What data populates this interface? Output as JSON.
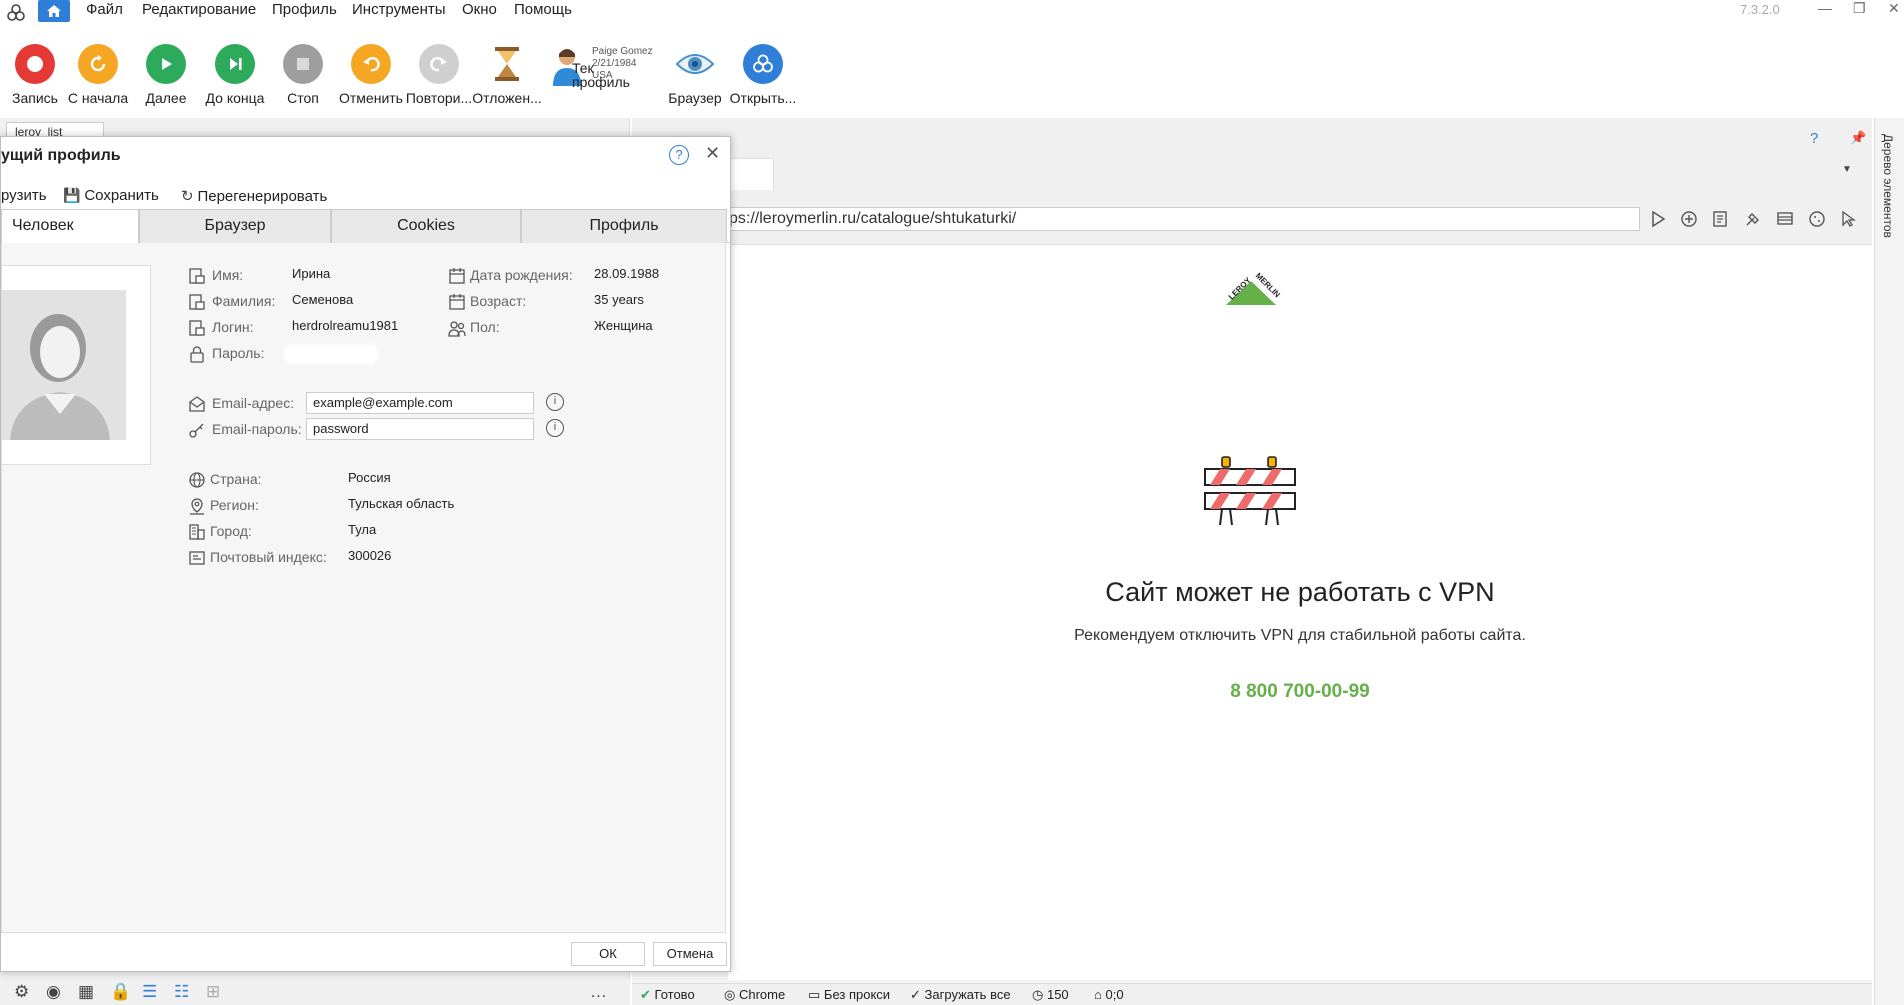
{
  "menu": {
    "items": [
      "Файл",
      "Редактирование",
      "Профиль",
      "Инструменты",
      "Окно",
      "Помощь"
    ],
    "version": "7.3.2.0"
  },
  "toolbar": {
    "buttons": [
      {
        "label": "Запись",
        "color": "#e53935",
        "icon": "record-icon"
      },
      {
        "label": "С начала",
        "color": "#f5a623",
        "icon": "restart-icon"
      },
      {
        "label": "Далее",
        "color": "#2eaa5c",
        "icon": "play-icon"
      },
      {
        "label": "До конца",
        "color": "#2eaa5c",
        "icon": "skip-end-icon"
      },
      {
        "label": "Стоп",
        "color": "#9e9e9e",
        "icon": "stop-icon"
      },
      {
        "label": "Отменить",
        "color": "#f5a623",
        "icon": "undo-icon"
      },
      {
        "label": "Повтори...",
        "color": "#cfcfcf",
        "icon": "redo-icon"
      },
      {
        "label": "Отложен...",
        "color": "#c0873f",
        "icon": "hourglass-icon"
      },
      {
        "label": "Браузер",
        "color": "#4a90c8",
        "icon": "eye-icon"
      },
      {
        "label": "Открыть...",
        "color": "#2f7fd8",
        "icon": "open-icon"
      }
    ],
    "profile": {
      "name": "Paige Gomez",
      "date": "2/21/1984",
      "country": "USA",
      "overlay_text": "Тек",
      "label": "профиль"
    }
  },
  "dialog": {
    "title": "ущий профиль",
    "actions": {
      "load": "рузить",
      "save": "Сохранить",
      "regenerate": "Перегенерировать"
    },
    "tabs": [
      "Человек",
      "Браузер",
      "Cookies",
      "Профиль"
    ],
    "person": {
      "first_name_label": "Имя:",
      "first_name": "Ирина",
      "last_name_label": "Фамилия:",
      "last_name": "Семенова",
      "login_label": "Логин:",
      "login": "herdrolreamu1981",
      "password_label": "Пароль:",
      "birth_label": "Дата рождения:",
      "birth": "28.09.1988",
      "age_label": "Возраст:",
      "age": "35 years",
      "gender_label": "Пол:",
      "gender": "Женщина",
      "email_label": "Email-адрес:",
      "email": "example@example.com",
      "email_pass_label": "Email-пароль:",
      "email_pass": "password",
      "country_label": "Страна:",
      "country": "Россия",
      "region_label": "Регион:",
      "region": "Тульская область",
      "city_label": "Город:",
      "city": "Тула",
      "zip_label": "Почтовый индекс:",
      "zip": "300026"
    },
    "ok": "ОК",
    "cancel": "Отмена"
  },
  "browser": {
    "url": "ps://leroymerlin.ru/catalogue/shtukaturki/",
    "side_panel_label": "Дерево элементов",
    "logo_text": "LEROY MERLIN",
    "headline": "Сайт может не работать с VPN",
    "subtext": "Рекомендуем отключить VPN для стабильной работы сайта.",
    "phone": "8 800 700-00-99",
    "phone_color": "#66b04a"
  },
  "status": {
    "ready": "Готово",
    "browser": "Chrome",
    "proxy": "Без прокси",
    "load": "Загружать все",
    "timer": "150",
    "coords": "0;0"
  },
  "left_tab": {
    "label": "leroy_list"
  }
}
